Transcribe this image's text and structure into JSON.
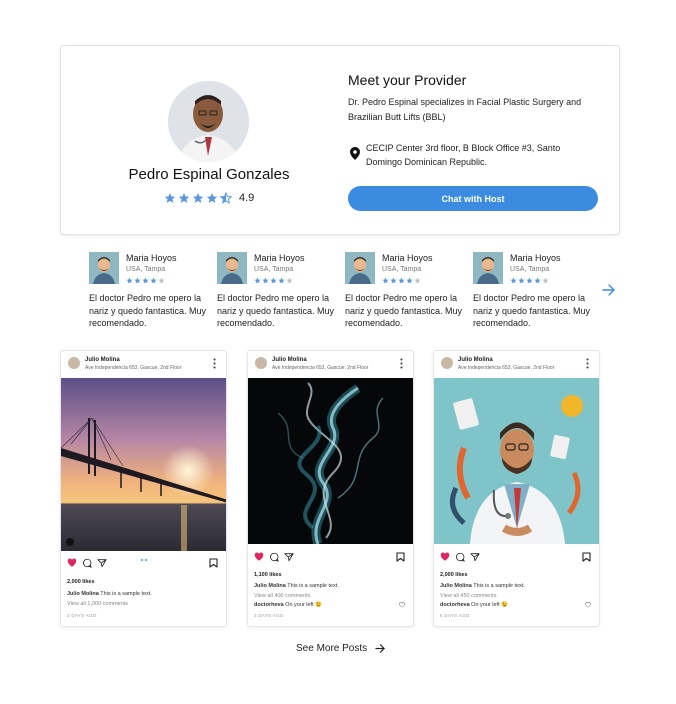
{
  "provider": {
    "name": "Pedro Espinal Gonzales",
    "rating_value": "4.9",
    "rating_stars": 4.5,
    "meet_title": "Meet your Provider",
    "description": "Dr. Pedro Espinal specializes in Facial Plastic Surgery and Brazilian Butt Lifts (BBL)",
    "location": "CECIP Center 3rd floor, B Block Office #3, Santo Domingo Dominican Republic.",
    "chat_label": "Chat with Host"
  },
  "reviews": [
    {
      "name": "Maria Hoyos",
      "location": "USA, Tampa",
      "stars": 4,
      "text": "El doctor Pedro me opero la nariz y quedo fantastica. Muy recomendado."
    },
    {
      "name": "Maria Hoyos",
      "location": "USA, Tampa",
      "stars": 4,
      "text": "El doctor Pedro me opero la nariz y quedo fantastica. Muy recomendado."
    },
    {
      "name": "Maria Hoyos",
      "location": "USA, Tampa",
      "stars": 4,
      "text": "El doctor Pedro me opero la nariz y quedo fantastica. Muy recomendado."
    },
    {
      "name": "Maria Hoyos",
      "location": "USA, Tampa",
      "stars": 4,
      "text": "El doctor Pedro me opero la nariz y quedo fantastica. Muy recomendado."
    }
  ],
  "posts": [
    {
      "user": "Julio Molina",
      "address": "Ave Independencia 653, Gascue, 2nd Floor",
      "likes": "2,000 likes",
      "caption_user": "Julio Molina",
      "caption_text": " This is a sample text.",
      "view_comments": "View all 1,000 comments",
      "comment_user": "",
      "comment_text": "",
      "time": "2 DAYS AGO"
    },
    {
      "user": "Julio Molina",
      "address": "Ave Independencia 653, Gascue, 2nd Floor",
      "likes": "1,100 likes",
      "caption_user": "Julio Molina",
      "caption_text": " This is a sample text.",
      "view_comments": "View all 400 comments",
      "comment_user": "doctorheva",
      "comment_text": " On your left 😉",
      "time": "3 DAYS AGO"
    },
    {
      "user": "Julio Molina",
      "address": "Ave Independencia 653, Gascue, 2nd Floor",
      "likes": "2,000 likes",
      "caption_user": "Julio Molina",
      "caption_text": " This is a sample text.",
      "view_comments": "View all 450 comments",
      "comment_user": "doctorheva",
      "comment_text": " On your left 😉",
      "time": "6 DAYS AGO"
    }
  ],
  "see_more_label": "See More Posts",
  "colors": {
    "accent": "#3b8ce0",
    "star": "#5b97e0",
    "star_empty": "#b8c2cc",
    "heart": "#e0245e"
  },
  "icons": [
    "location-pin-icon",
    "star-icon",
    "next-arrow-icon",
    "heart-icon",
    "comment-icon",
    "share-icon",
    "bookmark-icon",
    "more-vertical-icon",
    "arrow-right-icon"
  ]
}
